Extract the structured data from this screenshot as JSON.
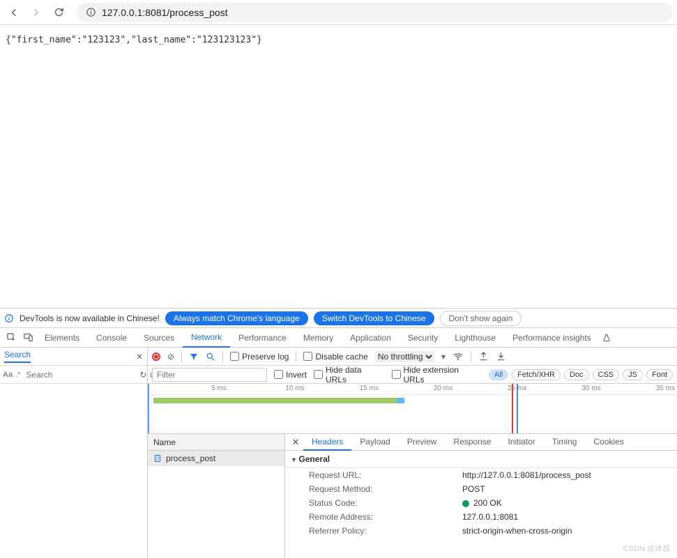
{
  "addressBar": {
    "url": "127.0.0.1:8081/process_post"
  },
  "page": {
    "body": "{\"first_name\":\"123123\",\"last_name\":\"123123123\"}"
  },
  "infoBar": {
    "message": "DevTools is now available in Chinese!",
    "btn1": "Always match Chrome's language",
    "btn2": "Switch DevTools to Chinese",
    "btn3": "Don't show again"
  },
  "mainTabs": [
    "Elements",
    "Console",
    "Sources",
    "Network",
    "Performance",
    "Memory",
    "Application",
    "Security",
    "Lighthouse",
    "Performance insights"
  ],
  "mainTabActive": "Network",
  "searchSide": {
    "label": "Search",
    "placeholder": "Search"
  },
  "netToolbar": {
    "preserveLog": "Preserve log",
    "disableCache": "Disable cache",
    "throttling": "No throttling"
  },
  "netFilter": {
    "placeholder": "Filter",
    "invert": "Invert",
    "hideData": "Hide data URLs",
    "hideExt": "Hide extension URLs",
    "types": [
      "All",
      "Fetch/XHR",
      "Doc",
      "CSS",
      "JS",
      "Font"
    ],
    "typeActive": "All"
  },
  "timeline": {
    "ticks": [
      "5 ms",
      "10 ms",
      "15 ms",
      "20 ms",
      "25 ms",
      "30 ms",
      "35 ms"
    ]
  },
  "reqList": {
    "header": "Name",
    "items": [
      "process_post"
    ]
  },
  "detailTabs": [
    "Headers",
    "Payload",
    "Preview",
    "Response",
    "Initiator",
    "Timing",
    "Cookies"
  ],
  "detailTabActive": "Headers",
  "general": {
    "title": "General",
    "rows": [
      {
        "k": "Request URL:",
        "v": "http://127.0.0.1:8081/process_post"
      },
      {
        "k": "Request Method:",
        "v": "POST"
      },
      {
        "k": "Status Code:",
        "v": "200 OK",
        "status": true
      },
      {
        "k": "Remote Address:",
        "v": "127.0.0.1:8081"
      },
      {
        "k": "Referrer Policy:",
        "v": "strict-origin-when-cross-origin"
      }
    ]
  },
  "watermark": "CSDN @沐叔"
}
